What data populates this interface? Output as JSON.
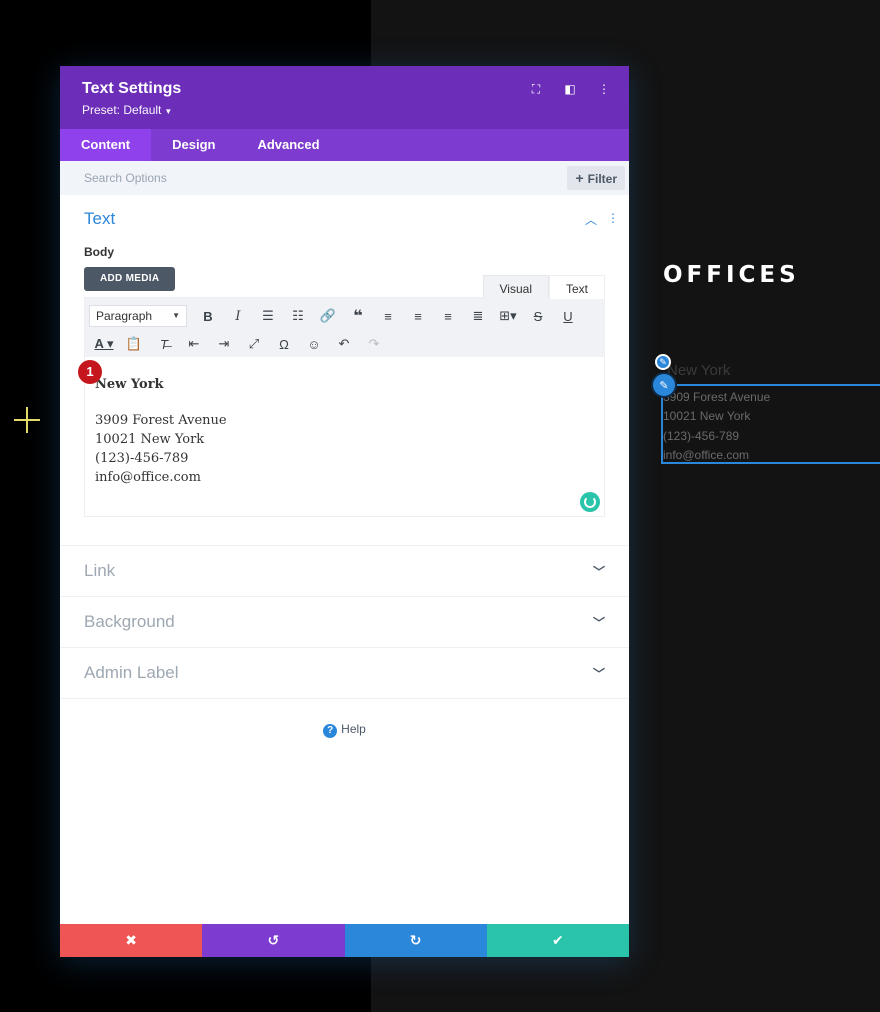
{
  "modal": {
    "title": "Text Settings",
    "preset": "Preset: Default",
    "header_icons": [
      "expand-icon",
      "split-view-icon",
      "more-vertical-icon"
    ]
  },
  "tabs": [
    {
      "label": "Content",
      "active": true
    },
    {
      "label": "Design",
      "active": false
    },
    {
      "label": "Advanced",
      "active": false
    }
  ],
  "search": {
    "placeholder": "Search Options",
    "filter_label": "Filter"
  },
  "text_section": {
    "title": "Text",
    "body_label": "Body",
    "add_media_label": "ADD MEDIA",
    "editor_tabs": [
      "Visual",
      "Text"
    ],
    "format_select": "Paragraph",
    "content": {
      "name": "New York",
      "lines": [
        "3909 Forest Avenue",
        "10021 New York",
        "(123)-456-789",
        "info@office.com"
      ]
    },
    "badge": "1"
  },
  "sections": [
    {
      "title": "Link"
    },
    {
      "title": "Background"
    },
    {
      "title": "Admin Label"
    }
  ],
  "help_label": "Help",
  "footer_icons": [
    "close-icon",
    "undo-icon",
    "redo-icon",
    "check-icon"
  ],
  "preview": {
    "title": "OFFICES",
    "name": "New York",
    "lines": [
      "3909 Forest Avenue",
      "10021 New York",
      "(123)-456-789",
      "info@office.com"
    ]
  },
  "colors": {
    "header": "#6c2eb9",
    "tabs": "#7e3bd0",
    "accent": "#2b87da",
    "cancel": "#ef5555",
    "save": "#29c4a9"
  }
}
